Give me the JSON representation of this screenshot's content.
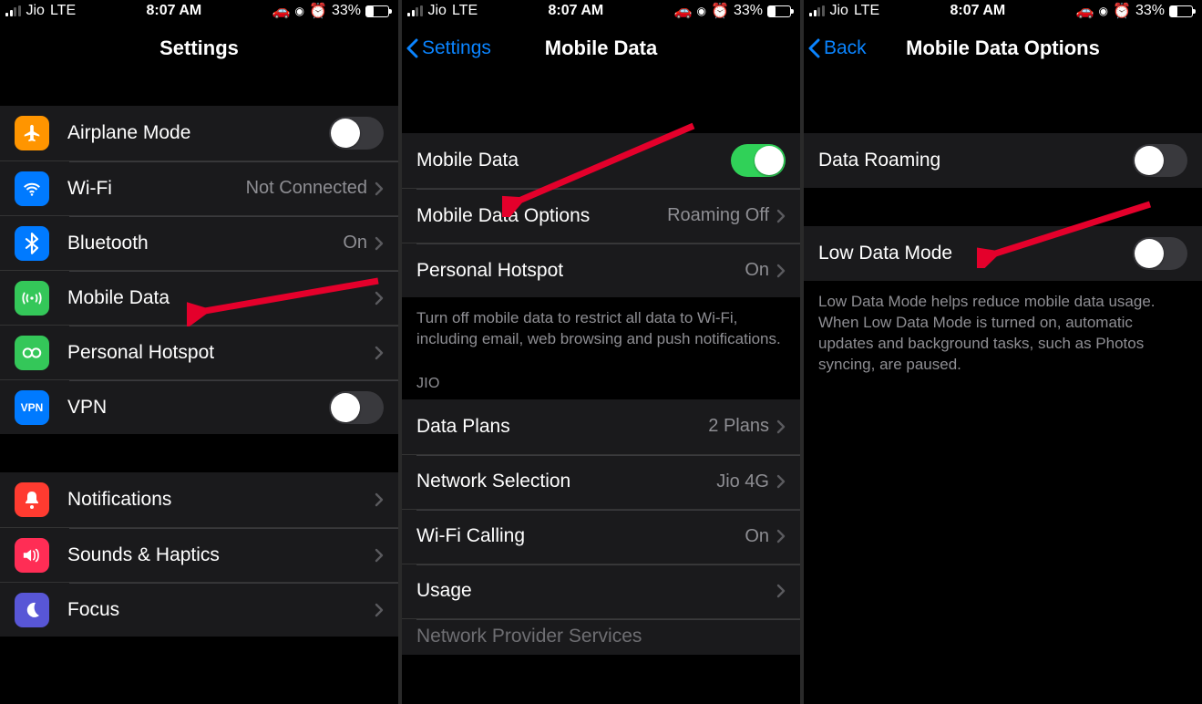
{
  "status": {
    "carrier": "Jio",
    "network": "LTE",
    "time": "8:07 AM",
    "battery_pct": "33%",
    "battery_fill_width": "33%"
  },
  "screen1": {
    "title": "Settings",
    "items": {
      "airplane": "Airplane Mode",
      "wifi": "Wi-Fi",
      "wifi_detail": "Not Connected",
      "bluetooth": "Bluetooth",
      "bluetooth_detail": "On",
      "mobile_data": "Mobile Data",
      "hotspot": "Personal Hotspot",
      "vpn": "VPN",
      "notifications": "Notifications",
      "sounds": "Sounds & Haptics",
      "focus": "Focus"
    }
  },
  "screen2": {
    "back": "Settings",
    "title": "Mobile Data",
    "items": {
      "mobile_data": "Mobile Data",
      "options": "Mobile Data Options",
      "options_detail": "Roaming Off",
      "hotspot": "Personal Hotspot",
      "hotspot_detail": "On",
      "footer": "Turn off mobile data to restrict all data to Wi-Fi, including email, web browsing and push notifications.",
      "section_header": "JIO",
      "data_plans": "Data Plans",
      "data_plans_detail": "2 Plans",
      "network_selection": "Network Selection",
      "network_selection_detail": "Jio 4G",
      "wifi_calling": "Wi-Fi Calling",
      "wifi_calling_detail": "On",
      "usage": "Usage",
      "network_provider": "Network Provider Services"
    }
  },
  "screen3": {
    "back": "Back",
    "title": "Mobile Data Options",
    "items": {
      "roaming": "Data Roaming",
      "low_data": "Low Data Mode",
      "footer": "Low Data Mode helps reduce mobile data usage. When Low Data Mode is turned on, automatic updates and background tasks, such as Photos syncing, are paused."
    }
  },
  "colors": {
    "orange": "#ff9500",
    "blue": "#007aff",
    "green": "#34c759",
    "red": "#ff3b30",
    "indigo": "#5856d6",
    "pink": "#ff2d55"
  }
}
